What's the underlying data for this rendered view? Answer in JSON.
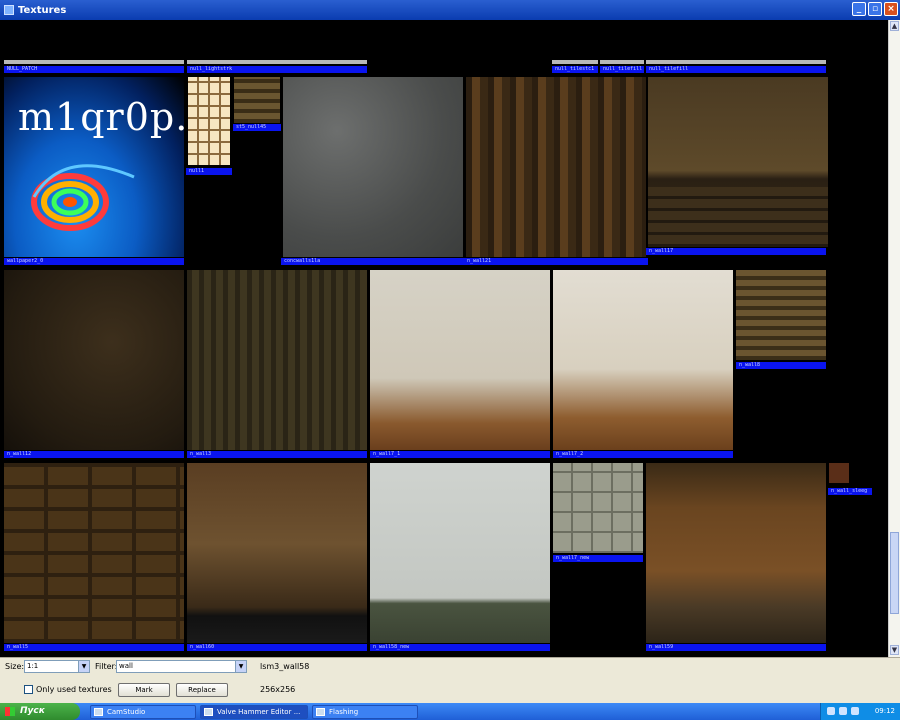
{
  "window": {
    "title": "Textures"
  },
  "titlebar": {
    "min": "_",
    "max": "▫",
    "close": "×"
  },
  "textures": [
    {
      "name": "NULL_PATCH"
    },
    {
      "name": "null_lightstrk"
    },
    {
      "name": "null_tilestc1"
    },
    {
      "name": "null_tilefill"
    },
    {
      "name": "null_tilefill"
    },
    {
      "name": "wallpaper2_0",
      "logo_text": "m1qr0p."
    },
    {
      "name": "null1"
    },
    {
      "name": "st5_null45"
    },
    {
      "name": "concwalls1la"
    },
    {
      "name": "n_wall21"
    },
    {
      "name": "n_wall17"
    },
    {
      "name": "n_wall1d"
    },
    {
      "name": "n_wall12"
    },
    {
      "name": "n_wall3"
    },
    {
      "name": "n_wall7_1"
    },
    {
      "name": "n_wall7_2"
    },
    {
      "name": "n_wall8"
    },
    {
      "name": "n_wall5"
    },
    {
      "name": "n_wall60"
    },
    {
      "name": "n_wall58_new"
    },
    {
      "name": "n_wall7_new"
    },
    {
      "name": "n_wall59"
    },
    {
      "name": "n_wall_sleeg"
    }
  ],
  "bottom": {
    "size_label": "Size:",
    "size_value": "1:1",
    "filter_label": "Filter:",
    "filter_value": "wall",
    "selected_name": "lsm3_wall58",
    "selected_size": "256x256",
    "only_used_label": "Only used textures",
    "mark_label": "Mark",
    "replace_label": "Replace"
  },
  "taskbar": {
    "start_label": "Пуск",
    "tasks": [
      {
        "label": "CamStudio"
      },
      {
        "label": "Valve Hammer Editor ..."
      },
      {
        "label": "Flashing"
      }
    ],
    "clock": "09:12"
  }
}
